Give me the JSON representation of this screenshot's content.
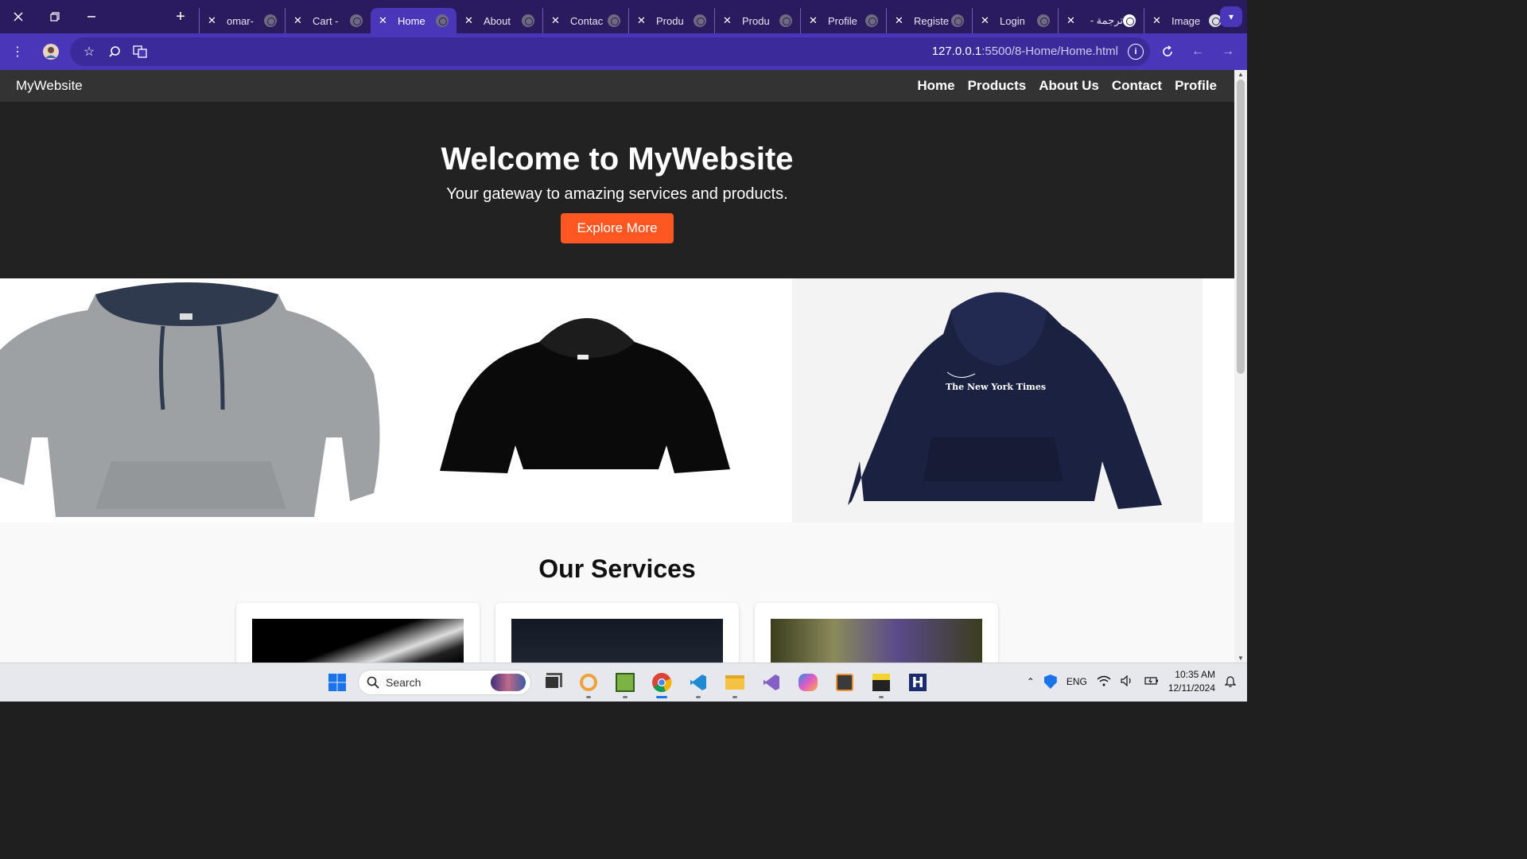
{
  "browser": {
    "tabs": [
      {
        "title": "omar-",
        "active": false
      },
      {
        "title": "Cart -",
        "active": false
      },
      {
        "title": "Home",
        "active": true
      },
      {
        "title": "About",
        "active": false
      },
      {
        "title": "Contac",
        "active": false
      },
      {
        "title": "Produ",
        "active": false
      },
      {
        "title": "Produ",
        "active": false
      },
      {
        "title": "Profile",
        "active": false
      },
      {
        "title": "Registe",
        "active": false
      },
      {
        "title": "Login",
        "active": false
      },
      {
        "title": "ترجمة -",
        "active": false
      },
      {
        "title": "Image",
        "active": false
      }
    ],
    "url_host": "127.0.0.1",
    "url_path": ":5500/8-Home/Home.html"
  },
  "site": {
    "brand": "MyWebsite",
    "nav": [
      "Home",
      "Products",
      "About Us",
      "Contact",
      "Profile"
    ],
    "hero": {
      "title": "Welcome to MyWebsite",
      "subtitle": "Your gateway to amazing services and products.",
      "cta": "Explore More"
    },
    "gallery": [
      "gray-hoodie",
      "black-hoodie",
      "navy-hoodie-nyt"
    ],
    "nyt_print": "The New York Times",
    "services_title": "Our Services"
  },
  "taskbar": {
    "search_placeholder": "Search",
    "language": "ENG",
    "time": "10:35 AM",
    "date": "12/11/2024"
  },
  "colors": {
    "tab_strip": "#2a1a5e",
    "toolbar": "#4a36b8",
    "hero_bg": "#222222",
    "cta": "#ff5722",
    "site_nav": "#333333"
  }
}
